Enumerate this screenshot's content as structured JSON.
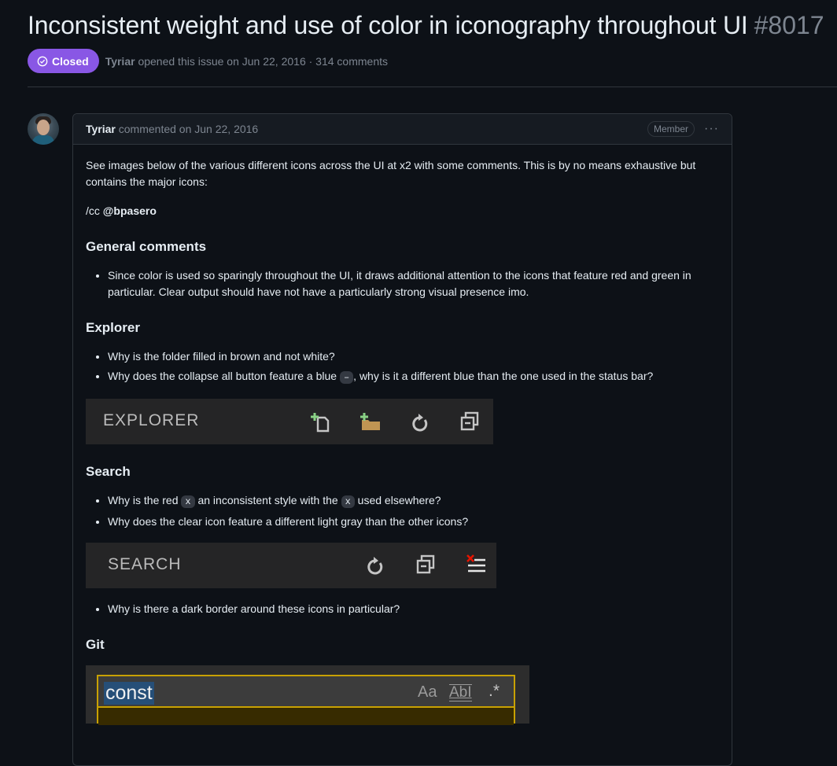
{
  "issue": {
    "title": "Inconsistent weight and use of color in iconography throughout UI",
    "number": "#8017",
    "status": "Closed",
    "author": "Tyriar",
    "meta": "opened this issue on Jun 22, 2016 · 314 comments"
  },
  "comment": {
    "author": "Tyriar",
    "meta": "commented on Jun 22, 2016",
    "role": "Member",
    "intro": "See images below of the various different icons across the UI at x2 with some comments. This is by no means exhaustive but contains the major icons:",
    "cc_prefix": "/cc",
    "cc_user": "@bpasero",
    "sections": {
      "general": {
        "heading": "General comments",
        "items": [
          "Since color is used so sparingly throughout the UI, it draws additional attention to the icons that feature red and green in particular. Clear output should have not have a particularly strong visual presence imo."
        ]
      },
      "explorer": {
        "heading": "Explorer",
        "item1": "Why is the folder filled in brown and not white?",
        "item2_a": "Why does the collapse all button feature a blue",
        "item2_code": "–",
        "item2_b": ", why is it a different blue than the one used in the status bar?",
        "shot_label": "EXPLORER"
      },
      "search": {
        "heading": "Search",
        "item1_a": "Why is the red",
        "item1_code": "x",
        "item1_b": "an inconsistent style with the",
        "item1_code2": "x",
        "item1_c": "used elsewhere?",
        "item2": "Why does the clear icon feature a different light gray than the other icons?",
        "shot_label": "SEARCH",
        "item3": "Why is there a dark border around these icons in particular?"
      },
      "git": {
        "heading": "Git",
        "input_value": "const",
        "opt_case": "Aa",
        "opt_word": "AbI",
        "opt_regex": ".*"
      }
    }
  }
}
